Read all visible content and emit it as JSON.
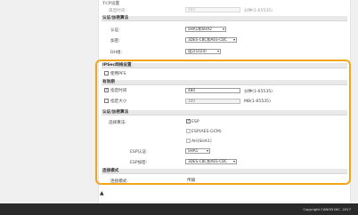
{
  "top_section": {
    "title": "TCP设置",
    "retry_label": "再启时间:",
    "retry_value": "480",
    "retry_unit": "分钟(1-65535)"
  },
  "auth_enc_top": {
    "title": "认证/加密算法",
    "auth_label": "认证:",
    "auth_value": "SHA1和SHA2",
    "enc_label": "加密:",
    "enc_value": "3DES-CBC和AES-CBC",
    "dh_label": "DH组:",
    "dh_value": "组2(1024)"
  },
  "ipsec": {
    "title": "IPSec网络设置",
    "pfs_label": "使用PFS",
    "validity_title": "有效期",
    "time_label": "指定时间",
    "time_value": "480",
    "time_unit": "分钟(1-65535)",
    "size_label": "指定大小",
    "size_value": "100",
    "size_unit": "MB(1-65535)",
    "auth_title": "认证/加密算法",
    "algo_label": "选择算法:",
    "esp_label": "ESP",
    "esp_aes_label": "ESP(AES-GCM)",
    "ah_label": "AH(SHA1)",
    "esp_auth_label": "ESP认证:",
    "esp_auth_value": "SHA1",
    "esp_enc_label": "ESP加密:",
    "esp_enc_value": "3DES-CBC和AES-CBC",
    "conn_title": "连接模式",
    "conn_label": "连接模式:",
    "conn_value": "传输"
  },
  "footer": {
    "back_to_top": "▲",
    "copyright": "Copyright CANON INC. 2017"
  },
  "colors": {
    "highlight": "#f2a51a",
    "footer": "#2a2a2a"
  }
}
